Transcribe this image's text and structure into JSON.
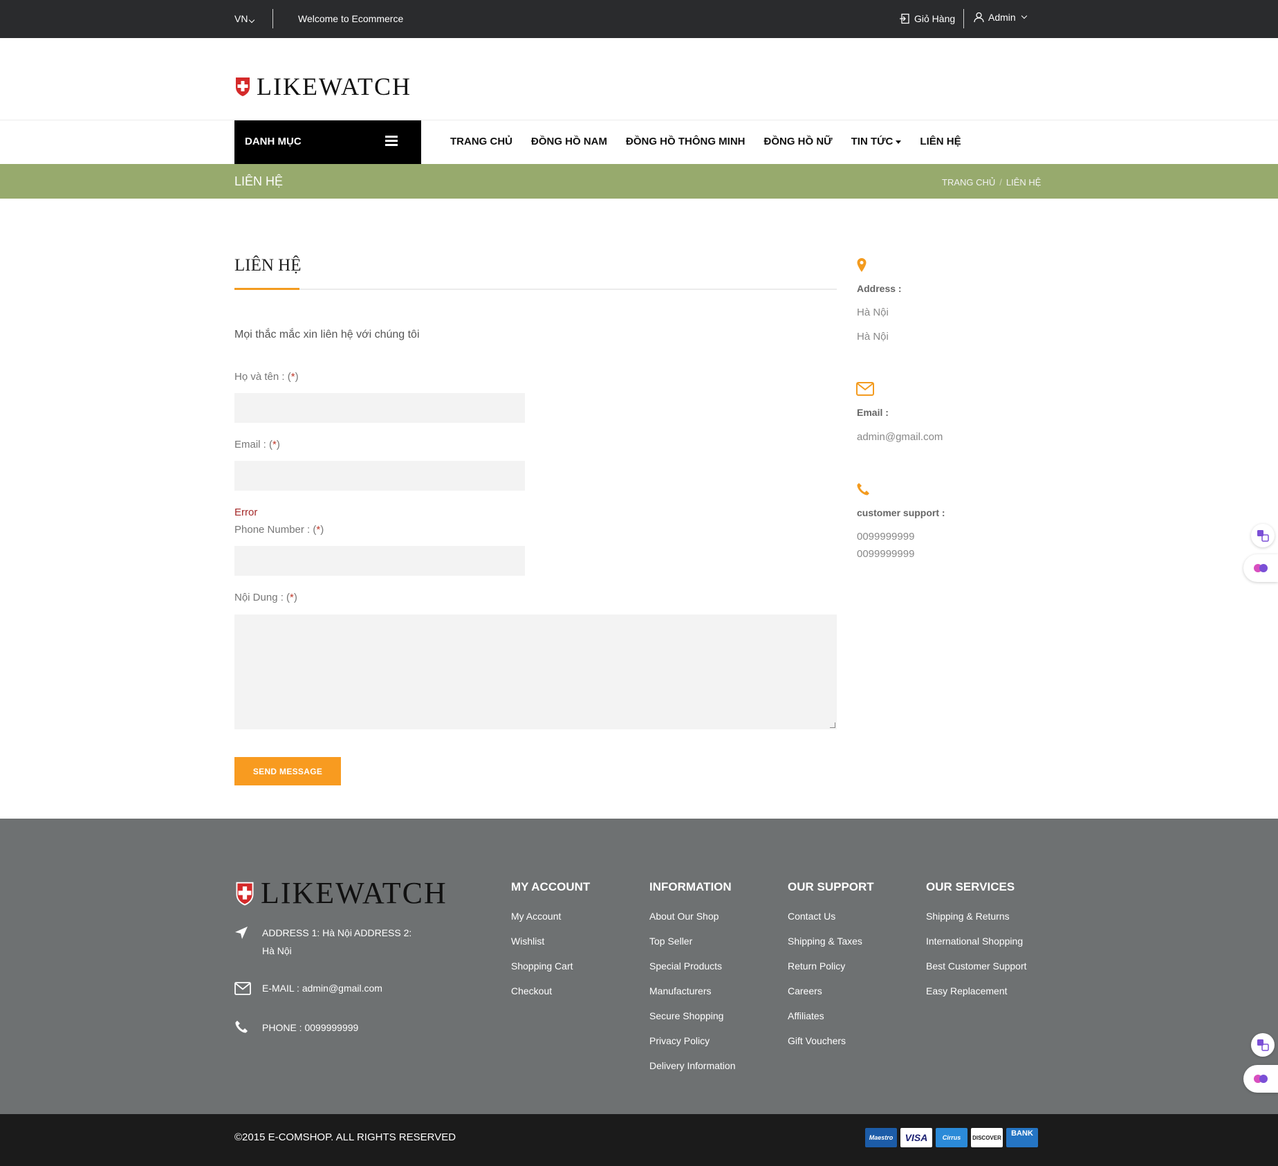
{
  "topbar": {
    "language": "VN",
    "welcome": "Welcome to Ecommerce",
    "cart_label": "Giỏ Hàng",
    "account_label": "Admin"
  },
  "header": {
    "logo_text": "LIKEWATCH"
  },
  "nav": {
    "category_label": "DANH MỤC",
    "items": [
      {
        "label": "TRANG CHỦ"
      },
      {
        "label": "ĐỒNG HỒ NAM"
      },
      {
        "label": "ĐỒNG HỒ THÔNG MINH"
      },
      {
        "label": "ĐỒNG HỒ NỮ"
      },
      {
        "label": "TIN TỨC"
      },
      {
        "label": "LIÊN HỆ"
      }
    ]
  },
  "breadcrumb": {
    "page_title": "LIÊN HỆ",
    "home": "TRANG CHỦ",
    "separator": "/",
    "current": "LIÊN HỆ"
  },
  "contact_form": {
    "heading": "LIÊN HỆ",
    "intro": "Mọi thắc mắc xin liên hệ với chúng tôi",
    "required_mark": "*",
    "name_label": "Họ và tên :",
    "email_label": "Email :",
    "error_text": "Error",
    "phone_label": "Phone Number :",
    "content_label": "Nội Dung :",
    "name_value": "",
    "email_value": "",
    "phone_value": "",
    "content_value": "",
    "submit_label": "SEND MESSAGE"
  },
  "contact_info": {
    "address_title": "Address :",
    "address_line1": "Hà Nội",
    "address_line2": "Hà Nội",
    "email_title": "Email :",
    "email_value": "admin@gmail.com",
    "support_title": "customer support :",
    "phone1": "0099999999",
    "phone2": "0099999999"
  },
  "footer": {
    "logo_text": "LIKEWATCH",
    "address_line1": "ADDRESS 1: Hà Nội ADDRESS 2:",
    "address_line2": "Hà Nội",
    "email": "E-MAIL : admin@gmail.com",
    "phone": "PHONE : 0099999999",
    "columns": [
      {
        "title": "MY ACCOUNT",
        "links": [
          "My Account",
          "Wishlist",
          "Shopping Cart",
          "Checkout"
        ]
      },
      {
        "title": "INFORMATION",
        "links": [
          "About Our Shop",
          "Top Seller",
          "Special Products",
          "Manufacturers",
          "Secure Shopping",
          "Privacy Policy",
          "Delivery Information"
        ]
      },
      {
        "title": "OUR SUPPORT",
        "links": [
          "Contact Us",
          "Shipping & Taxes",
          "Return Policy",
          "Careers",
          "Affiliates",
          "Gift Vouchers"
        ]
      },
      {
        "title": "OUR SERVICES",
        "links": [
          "Shipping & Returns",
          "International Shopping",
          "Best Customer Support",
          "Easy Replacement"
        ]
      }
    ],
    "copyright": "©2015 E-COMSHOP. ALL RIGHTS RESERVED",
    "payment_cards": [
      "Maestro",
      "VISA",
      "Cirrus",
      "DISCOVER",
      "BANK"
    ]
  },
  "colors": {
    "topbar_bg": "#2a2b2d",
    "accent": "#f89b20",
    "breadcrumb_bg": "#97aa6d",
    "footer_bg": "#6e7172",
    "bottombar_bg": "#1b1b1b"
  }
}
